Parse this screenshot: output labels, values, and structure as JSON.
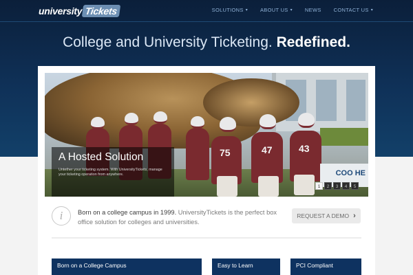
{
  "header": {
    "logo_text_a": "university",
    "logo_text_b": "Tickets",
    "nav": [
      {
        "label": "SOLUTIONS",
        "has_caret": true
      },
      {
        "label": "ABOUT US",
        "has_caret": true
      },
      {
        "label": "NEWS",
        "has_caret": false
      },
      {
        "label": "CONTACT US",
        "has_caret": true
      }
    ],
    "caret_icon": "chevron-down-icon"
  },
  "hero": {
    "headline_part1": "College and University Ticketing.",
    "headline_part2": "Redefined."
  },
  "slider": {
    "caption_title": "A Hosted Solution",
    "caption_text": "Untether your ticketing system. With UniversityTickets, manage your ticketing operation from anywhere.",
    "pages": [
      "1",
      "2",
      "3",
      "4",
      "5"
    ],
    "active_page": "1",
    "jersey_numbers": [
      "75",
      "47",
      "43"
    ],
    "sign_text": "COO HE"
  },
  "intro": {
    "icon": "info-icon",
    "lead": "Born on a college campus in 1999.",
    "rest": "UniversityTickets is the perfect box office solution for colleges and universities.",
    "button_label": "REQUEST A DEMO",
    "button_icon": "chevron-right-icon"
  },
  "features": [
    {
      "title": "Born on a College Campus"
    },
    {
      "title": "Easy to Learn"
    },
    {
      "title": "PCI Compliant"
    }
  ],
  "colors": {
    "navy": "#0e3260",
    "hero_dark": "#0b1f3a",
    "nav_text": "#8fb1d6",
    "maroon": "#7a2a2f"
  }
}
